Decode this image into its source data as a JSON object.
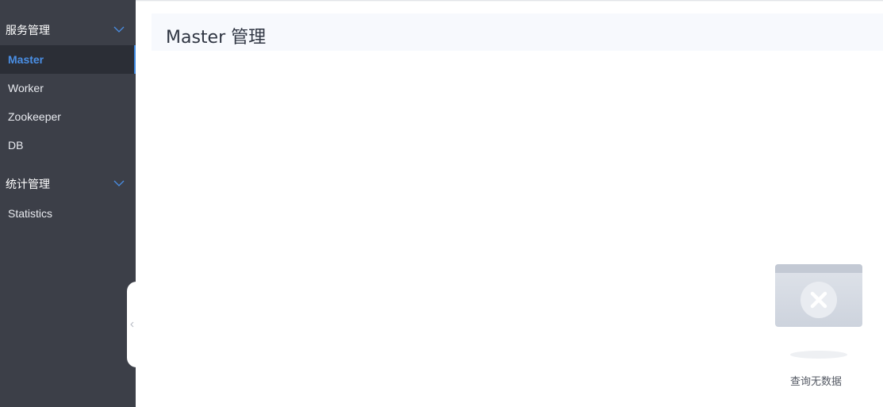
{
  "sidebar": {
    "groups": [
      {
        "title": "服务管理",
        "items": [
          "Master",
          "Worker",
          "Zookeeper",
          "DB"
        ]
      },
      {
        "title": "统计管理",
        "items": [
          "Statistics"
        ]
      }
    ],
    "active_item": "Master"
  },
  "main": {
    "title": "Master 管理",
    "empty_text": "查询无数据"
  },
  "colors": {
    "sidebar_bg": "#3c3f48",
    "active_item_bg": "#2b2e36",
    "accent": "#4a8fe5",
    "title_bar_bg": "#f7f9fd"
  },
  "icons": [
    "chevron-down-icon",
    "collapse-left-icon",
    "empty-data-icon"
  ]
}
